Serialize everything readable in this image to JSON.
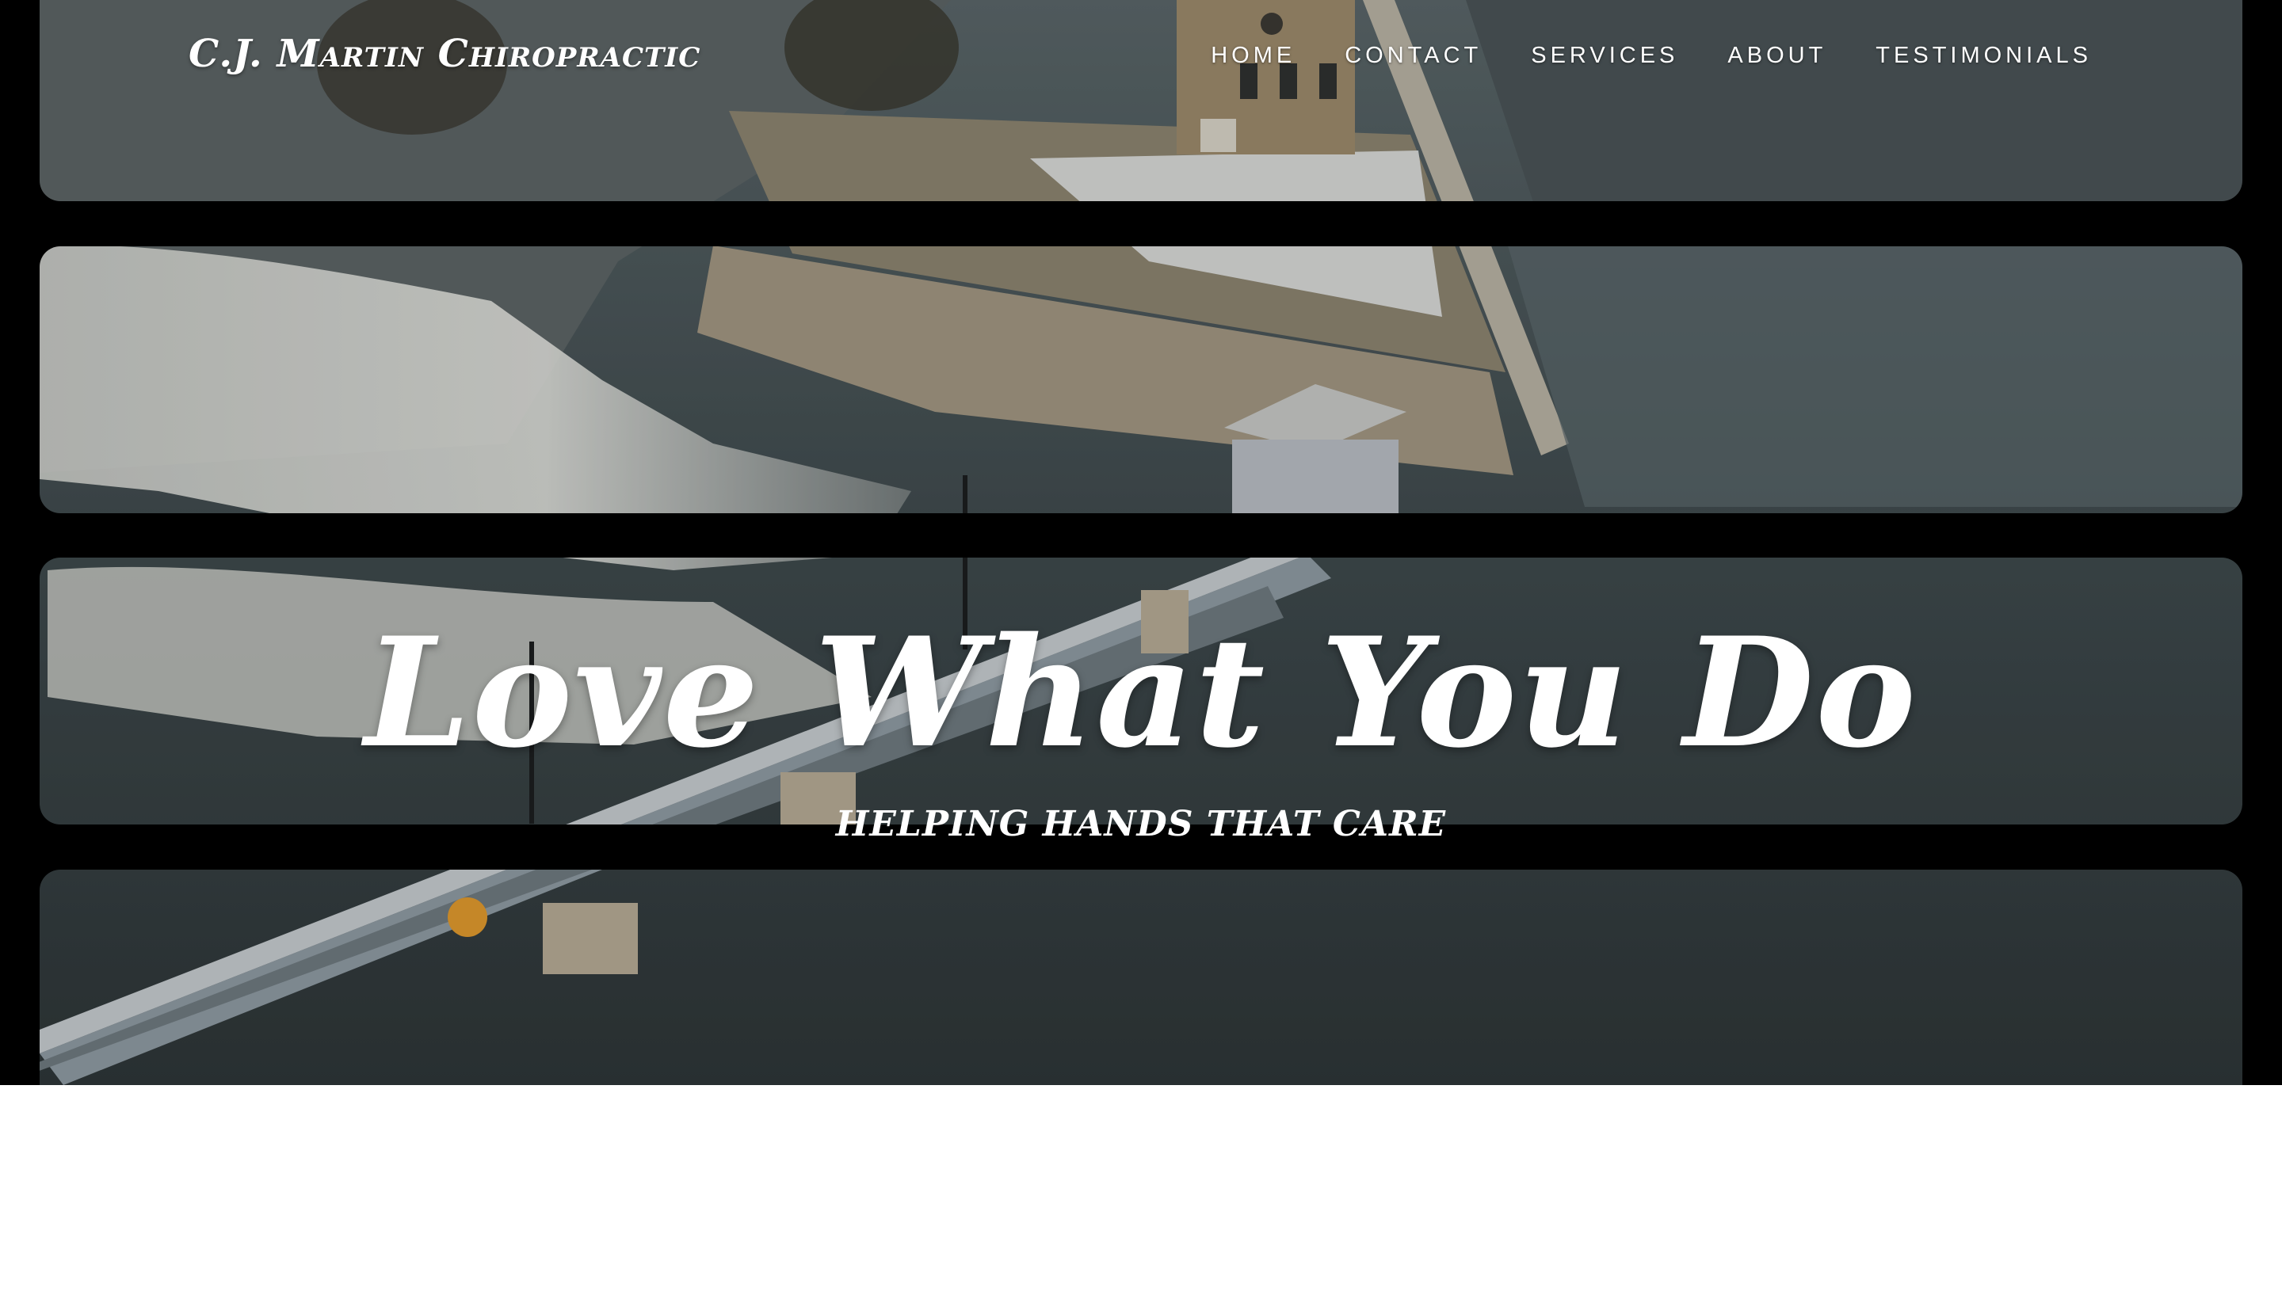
{
  "brand": {
    "name": "C.J. Martin Chiropractic"
  },
  "nav": {
    "items": [
      {
        "label": "HOME"
      },
      {
        "label": "CONTACT"
      },
      {
        "label": "SERVICES"
      },
      {
        "label": "ABOUT"
      },
      {
        "label": "TESTIMONIALS"
      }
    ]
  },
  "hero": {
    "headline": "Love What You Do",
    "tagline": "HELPING HANDS THAT CARE",
    "background": "aerial-river-dam-scene",
    "colors": {
      "water_dark": "#3a4548",
      "water_mid": "#5c6a6e",
      "rapids": "#d9dad5",
      "concrete": "#a59a86",
      "snow": "#e8ebec",
      "brick": "#9d8a6c"
    }
  }
}
